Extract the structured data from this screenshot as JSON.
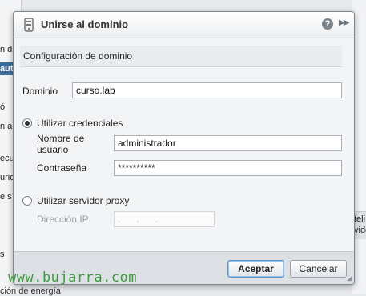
{
  "background": {
    "left_fragments": [
      "n d",
      "aut",
      "ó",
      "n a",
      "ecu",
      "urid",
      "e s",
      "s"
    ],
    "right_fragments": [
      "teli",
      "vido"
    ],
    "bottom_fragment": "ción de energía"
  },
  "dialog": {
    "title": "Unirse al dominio",
    "icon": "server-icon",
    "help_label": "?",
    "expand_label": "▶▶",
    "section_title": "Configuración de dominio",
    "domain_label": "Dominio",
    "domain_value": "curso.lab",
    "use_credentials_label": "Utilizar credenciales",
    "username_label_line1": "Nombre de",
    "username_label_line2": "usuario",
    "username_value": "administrador",
    "password_label": "Contraseña",
    "password_value": "**********",
    "use_proxy_label": "Utilizar servidor proxy",
    "ip_label": "Dirección IP",
    "ip_value": ".      .      .",
    "accept_label": "Aceptar",
    "cancel_label": "Cancelar"
  },
  "watermark": "www.bujarra.com"
}
